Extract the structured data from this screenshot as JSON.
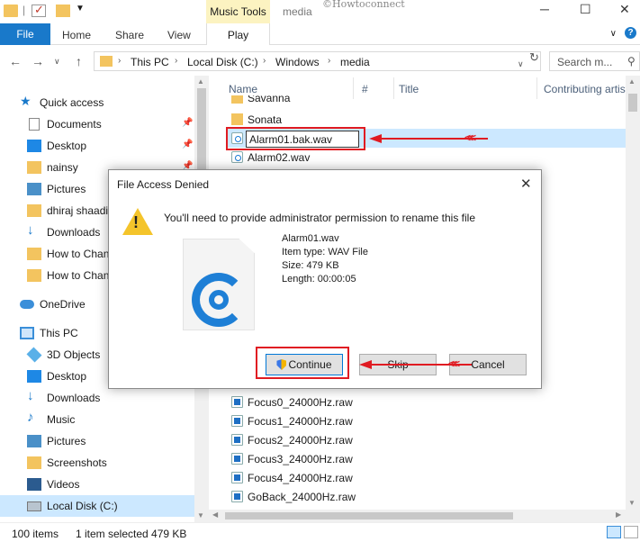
{
  "titlebar": {
    "context_tab": "Music Tools",
    "window_title": "media",
    "watermark": "©Howtoconnect",
    "minimize": "─",
    "maximize": "☐",
    "close": "✕"
  },
  "ribbon": {
    "tabs": [
      "File",
      "Home",
      "Share",
      "View",
      "Play"
    ]
  },
  "address": {
    "crumbs": [
      "This PC",
      "Local Disk (C:)",
      "Windows",
      "media"
    ],
    "search_placeholder": "Search m..."
  },
  "sidebar": {
    "items": [
      {
        "label": "Quick access",
        "icon": "star-icon",
        "pinned": false
      },
      {
        "label": "Documents",
        "icon": "documents-icon",
        "pinned": true
      },
      {
        "label": "Desktop",
        "icon": "desktop-icon",
        "pinned": true
      },
      {
        "label": "nainsy",
        "icon": "folder-icon",
        "pinned": true
      },
      {
        "label": "Pictures",
        "icon": "pictures-icon",
        "pinned": true
      },
      {
        "label": "dhiraj shaadi",
        "icon": "folder-icon",
        "pinned": false
      },
      {
        "label": "Downloads",
        "icon": "downloads-icon",
        "pinned": false
      },
      {
        "label": "How to Chan",
        "icon": "folder-icon",
        "pinned": false
      },
      {
        "label": "How to Chan",
        "icon": "folder-icon",
        "pinned": false
      },
      {
        "label": "OneDrive",
        "icon": "onedrive-icon",
        "pinned": false
      },
      {
        "label": "This PC",
        "icon": "pc-icon",
        "pinned": false
      },
      {
        "label": "3D Objects",
        "icon": "3d-objects-icon",
        "pinned": false
      },
      {
        "label": "Desktop",
        "icon": "desktop-icon",
        "pinned": false
      },
      {
        "label": "Downloads",
        "icon": "downloads-icon",
        "pinned": false
      },
      {
        "label": "Music",
        "icon": "music-icon",
        "pinned": false
      },
      {
        "label": "Pictures",
        "icon": "pictures-icon",
        "pinned": false
      },
      {
        "label": "Screenshots",
        "icon": "folder-icon",
        "pinned": false
      },
      {
        "label": "Videos",
        "icon": "videos-icon",
        "pinned": false
      },
      {
        "label": "Local Disk (C:)",
        "icon": "drive-icon",
        "pinned": false
      }
    ]
  },
  "filelist": {
    "columns": [
      "Name",
      "#",
      "Title",
      "Contributing artists"
    ],
    "top_rows": [
      {
        "name": "Savanna",
        "type": "folder"
      },
      {
        "name": "Sonata",
        "type": "folder"
      },
      {
        "name": "",
        "type": "wav"
      },
      {
        "name": "Alarm02.wav",
        "type": "wav"
      }
    ],
    "rename_value": "Alarm01.bak.wav",
    "bottom_rows": [
      {
        "name": "Focus0_24000Hz.raw",
        "type": "raw"
      },
      {
        "name": "Focus1_24000Hz.raw",
        "type": "raw"
      },
      {
        "name": "Focus2_24000Hz.raw",
        "type": "raw"
      },
      {
        "name": "Focus3_24000Hz.raw",
        "type": "raw"
      },
      {
        "name": "Focus4_24000Hz.raw",
        "type": "raw"
      },
      {
        "name": "GoBack_24000Hz.raw",
        "type": "raw"
      }
    ]
  },
  "status": {
    "item_count": "100 items",
    "selection": "1 item selected  479 KB"
  },
  "dialog": {
    "title": "File Access Denied",
    "message": "You'll need to provide administrator permission to rename this file",
    "file_name": "Alarm01.wav",
    "item_type": "Item type: WAV File",
    "size": "Size: 479 KB",
    "length": "Length: 00:00:05",
    "buttons": {
      "continue": "Continue",
      "skip": "Skip",
      "cancel": "Cancel"
    }
  },
  "colors": {
    "accent": "#1979ca",
    "selection": "#cce8ff",
    "annotation": "#e01b22",
    "music_tools": "#fcf3c1"
  }
}
